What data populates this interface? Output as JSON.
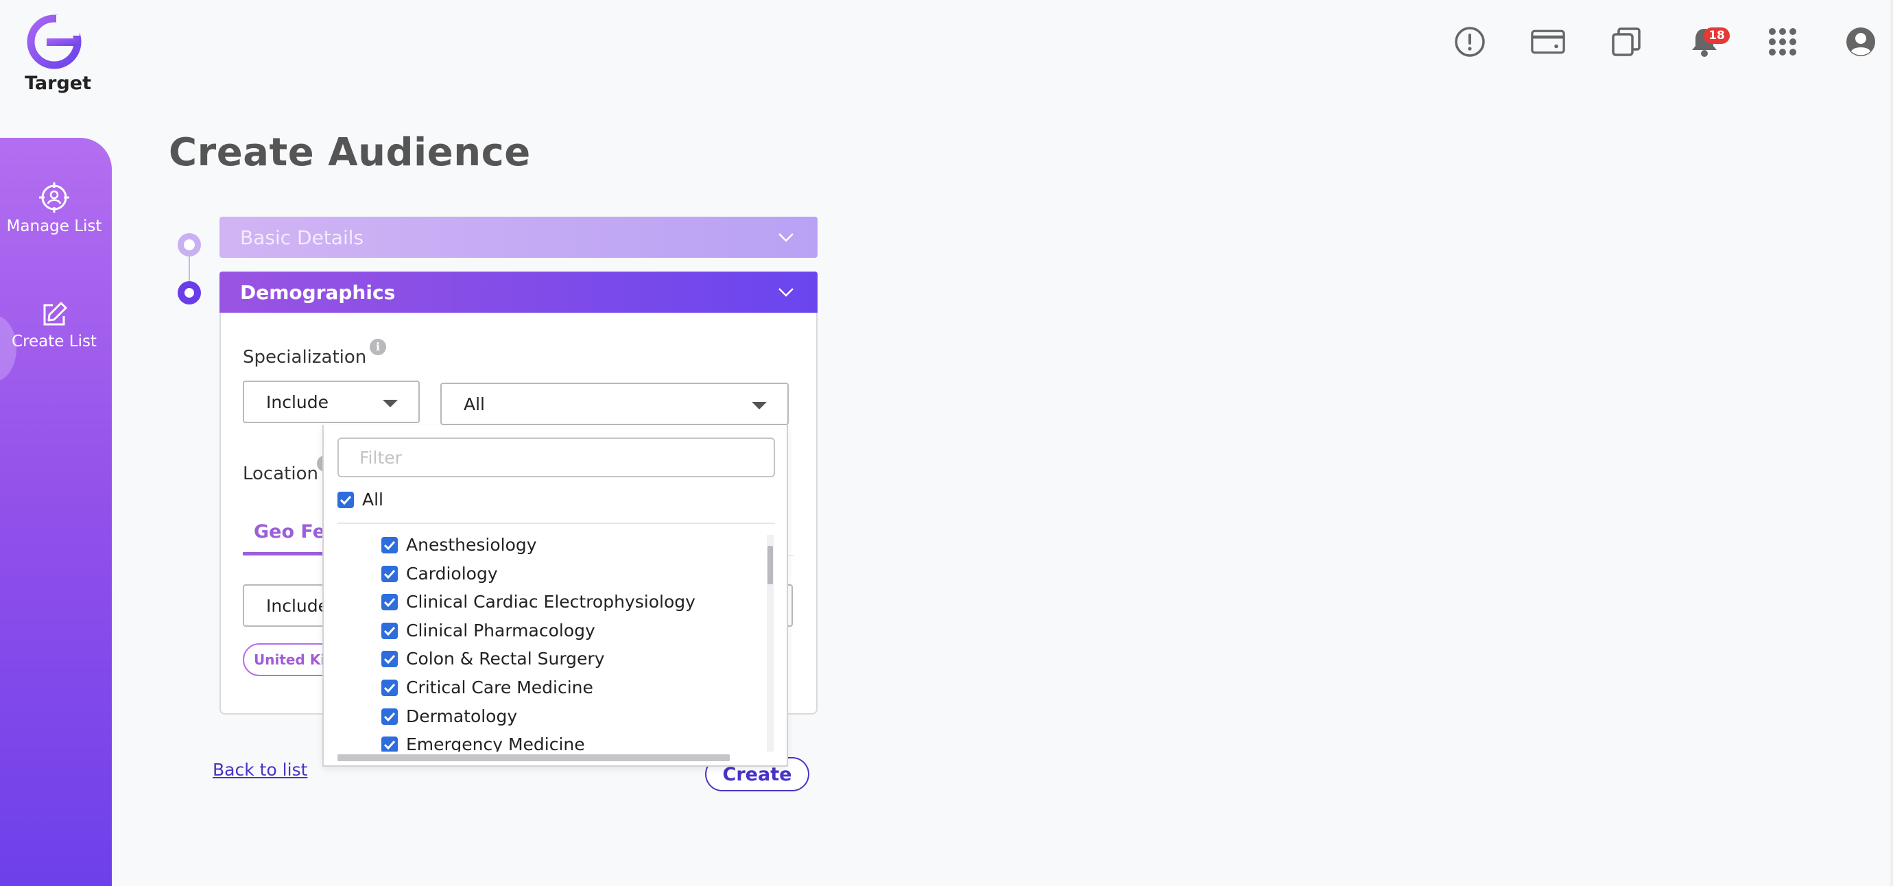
{
  "app": {
    "name": "Target",
    "brand_color": "#8a4fe6"
  },
  "topbar": {
    "icons": [
      "alert-icon",
      "card-icon",
      "copy-icon",
      "bell-icon",
      "apps-grid-icon",
      "account-icon"
    ],
    "notification_count": "18"
  },
  "sidebar": {
    "items": [
      {
        "label": "Manage List",
        "icon": "target-user-icon"
      },
      {
        "label": "Create List",
        "icon": "edit-icon"
      }
    ]
  },
  "page": {
    "title": "Create Audience"
  },
  "steps": [
    {
      "label": "Basic Details",
      "state": "collapsed"
    },
    {
      "label": "Demographics",
      "state": "expanded"
    }
  ],
  "demographics": {
    "specialization": {
      "label": "Specialization",
      "mode": "Include",
      "value": "All"
    },
    "location": {
      "label": "Location",
      "tab": "Geo Fencing",
      "mode": "Include",
      "chip": "United Kingdom"
    }
  },
  "dropdown": {
    "filter_placeholder": "Filter",
    "all_label": "All",
    "items": [
      "Anesthesiology",
      "Cardiology",
      "Clinical Cardiac Electrophysiology",
      "Clinical Pharmacology",
      "Colon & Rectal Surgery",
      "Critical Care Medicine",
      "Dermatology",
      "Emergency Medicine"
    ]
  },
  "actions": {
    "back_label": "Back to list",
    "create_label": "Create"
  }
}
